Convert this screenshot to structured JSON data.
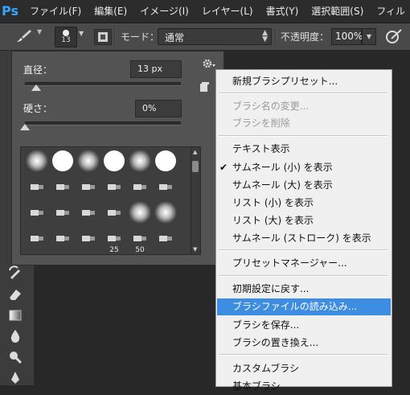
{
  "menubar": {
    "logo": "Ps",
    "items": [
      "ファイル(F)",
      "編集(E)",
      "イメージ(I)",
      "レイヤー(L)",
      "書式(Y)",
      "選択範囲(S)",
      "フィル"
    ]
  },
  "options": {
    "brush_size": "13",
    "mode_label": "モード：",
    "mode_value": "通常",
    "opacity_label": "不透明度：",
    "opacity_value": "100%"
  },
  "picker": {
    "size_label": "直径：",
    "size_value": "13 px",
    "size_fraction": 0.07,
    "hardness_label": "硬さ：",
    "hardness_value": "0%",
    "hardness_fraction": 0.0,
    "presets": [
      {
        "kind": "soft-round",
        "caption": ""
      },
      {
        "kind": "hard-round",
        "caption": ""
      },
      {
        "kind": "soft-round",
        "caption": ""
      },
      {
        "kind": "hard-round",
        "caption": ""
      },
      {
        "kind": "soft-round",
        "caption": ""
      },
      {
        "kind": "hard-round",
        "caption": ""
      },
      {
        "kind": "tip",
        "caption": ""
      },
      {
        "kind": "tip",
        "caption": ""
      },
      {
        "kind": "tip",
        "caption": ""
      },
      {
        "kind": "tip",
        "caption": ""
      },
      {
        "kind": "tip",
        "caption": ""
      },
      {
        "kind": "tip",
        "caption": ""
      },
      {
        "kind": "tip",
        "caption": ""
      },
      {
        "kind": "tip",
        "caption": ""
      },
      {
        "kind": "tip",
        "caption": ""
      },
      {
        "kind": "tip",
        "caption": ""
      },
      {
        "kind": "soft-round",
        "caption": ""
      },
      {
        "kind": "soft-round",
        "caption": ""
      },
      {
        "kind": "tip",
        "caption": ""
      },
      {
        "kind": "tip",
        "caption": ""
      },
      {
        "kind": "tip",
        "caption": ""
      },
      {
        "kind": "tip",
        "caption": "25"
      },
      {
        "kind": "tip",
        "caption": "50"
      },
      {
        "kind": "tip",
        "caption": ""
      }
    ]
  },
  "menu": {
    "items": [
      {
        "label": "新規ブラシプリセット...",
        "state": "normal"
      },
      {
        "label": "ブラシ名の変更...",
        "state": "disabled"
      },
      {
        "label": "ブラシを削除",
        "state": "disabled"
      },
      {
        "label": "テキスト表示",
        "state": "normal"
      },
      {
        "label": "サムネール (小) を表示",
        "state": "checked"
      },
      {
        "label": "サムネール (大) を表示",
        "state": "normal"
      },
      {
        "label": "リスト (小) を表示",
        "state": "normal"
      },
      {
        "label": "リスト (大) を表示",
        "state": "normal"
      },
      {
        "label": "サムネール (ストローク) を表示",
        "state": "normal"
      },
      {
        "label": "プリセットマネージャー...",
        "state": "normal"
      },
      {
        "label": "初期設定に戻す...",
        "state": "normal"
      },
      {
        "label": "ブラシファイルの読み込み...",
        "state": "highlighted"
      },
      {
        "label": "ブラシを保存...",
        "state": "normal"
      },
      {
        "label": "ブラシの置き換え...",
        "state": "normal"
      },
      {
        "label": "カスタムブラシ",
        "state": "normal"
      },
      {
        "label": "基本ブラシ",
        "state": "normal"
      }
    ],
    "check_mark": "✔"
  },
  "colors": {
    "highlight": "#3d8ee2",
    "ps_blue": "#31a8ff"
  }
}
